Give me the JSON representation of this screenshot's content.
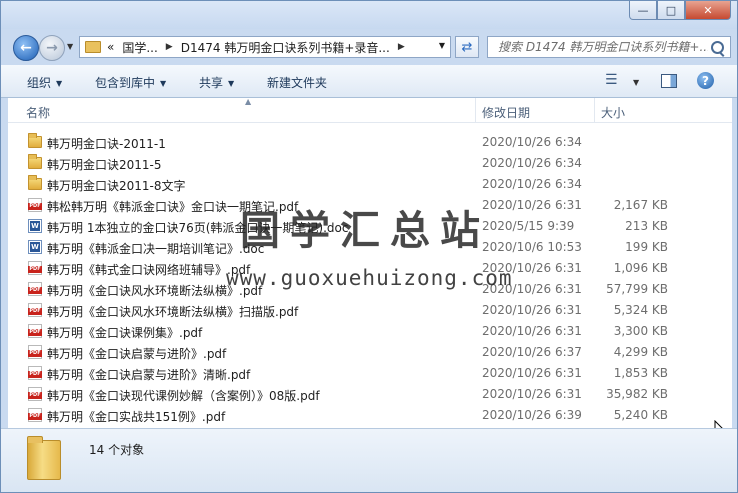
{
  "address": {
    "segments": [
      "国学...",
      "D1474 韩万明金口诀系列书籍+录音..."
    ],
    "overflow_glyph": "«"
  },
  "search": {
    "placeholder": "搜索 D1474 韩万明金口诀系列书籍+..."
  },
  "toolbar": {
    "organize": "组织",
    "include_library": "包含到库中",
    "share": "共享",
    "new_folder": "新建文件夹"
  },
  "columns": {
    "name": "名称",
    "date": "修改日期",
    "size": "大小"
  },
  "files": [
    {
      "type": "folder",
      "name": "韩万明金口诀-2011-1",
      "date": "2020/10/26 6:34",
      "size": ""
    },
    {
      "type": "folder",
      "name": "韩万明金口诀2011-5",
      "date": "2020/10/26 6:34",
      "size": ""
    },
    {
      "type": "folder",
      "name": "韩万明金口诀2011-8文字",
      "date": "2020/10/26 6:34",
      "size": ""
    },
    {
      "type": "pdf",
      "name": "韩松韩万明《韩派金口诀》金口诀一期笔记.pdf",
      "date": "2020/10/26 6:31",
      "size": "2,167 KB"
    },
    {
      "type": "doc",
      "name": "韩万明  1本独立的金口诀76页(韩派金口诀一期笔记).doc",
      "date": "2020/5/15 9:39",
      "size": "213 KB"
    },
    {
      "type": "doc",
      "name": "韩万明《韩派金口决一期培训笔记》.doc",
      "date": "2020/10/6 10:53",
      "size": "199 KB"
    },
    {
      "type": "pdf",
      "name": "韩万明《韩式金口诀网络班辅导》.pdf",
      "date": "2020/10/26 6:31",
      "size": "1,096 KB"
    },
    {
      "type": "pdf",
      "name": "韩万明《金口诀风水环境断法纵横》.pdf",
      "date": "2020/10/26 6:31",
      "size": "57,799 KB"
    },
    {
      "type": "pdf",
      "name": "韩万明《金口诀风水环境断法纵横》扫描版.pdf",
      "date": "2020/10/26 6:31",
      "size": "5,324 KB"
    },
    {
      "type": "pdf",
      "name": "韩万明《金口诀课例集》.pdf",
      "date": "2020/10/26 6:31",
      "size": "3,300 KB"
    },
    {
      "type": "pdf",
      "name": "韩万明《金口诀启蒙与进阶》.pdf",
      "date": "2020/10/26 6:37",
      "size": "4,299 KB"
    },
    {
      "type": "pdf",
      "name": "韩万明《金口诀启蒙与进阶》清晰.pdf",
      "date": "2020/10/26 6:31",
      "size": "1,853 KB"
    },
    {
      "type": "pdf",
      "name": "韩万明《金口诀现代课例妙解（含案例）》08版.pdf",
      "date": "2020/10/26 6:31",
      "size": "35,982 KB"
    },
    {
      "type": "pdf",
      "name": "韩万明《金口实战共151例》.pdf",
      "date": "2020/10/26 6:39",
      "size": "5,240 KB"
    }
  ],
  "watermark": {
    "title": "国学汇总站",
    "url": "www.guoxuehuizong.com"
  },
  "status": {
    "count": "14 个对象"
  },
  "colors": {
    "title_bg": "#c9daf0",
    "close_red": "#c64a31",
    "pdf_red": "#c8231c"
  }
}
